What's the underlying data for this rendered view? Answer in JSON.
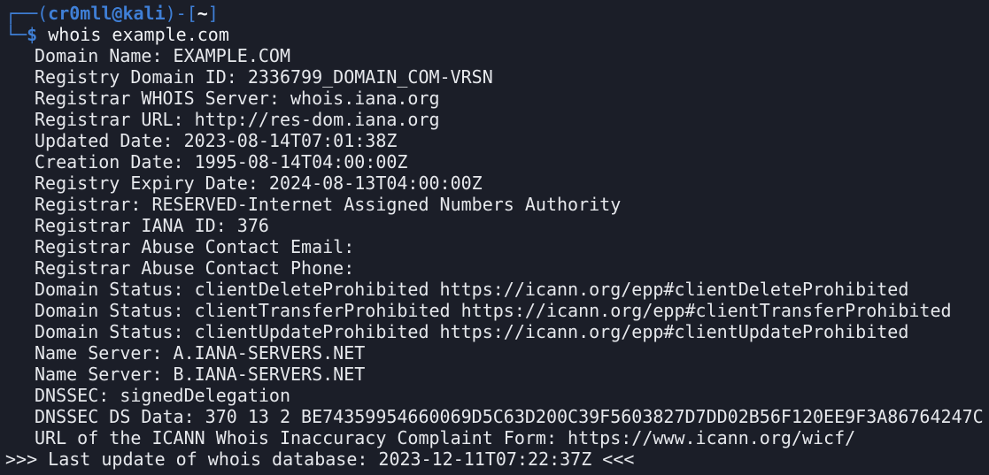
{
  "prompt": {
    "user_host": "cr0mll@kali",
    "cwd": "~",
    "symbol": "$",
    "command": "whois example.com"
  },
  "output_lines": [
    "Domain Name: EXAMPLE.COM",
    "Registry Domain ID: 2336799_DOMAIN_COM-VRSN",
    "Registrar WHOIS Server: whois.iana.org",
    "Registrar URL: http://res-dom.iana.org",
    "Updated Date: 2023-08-14T07:01:38Z",
    "Creation Date: 1995-08-14T04:00:00Z",
    "Registry Expiry Date: 2024-08-13T04:00:00Z",
    "Registrar: RESERVED-Internet Assigned Numbers Authority",
    "Registrar IANA ID: 376",
    "Registrar Abuse Contact Email:",
    "Registrar Abuse Contact Phone:",
    "Domain Status: clientDeleteProhibited https://icann.org/epp#clientDeleteProhibited",
    "Domain Status: clientTransferProhibited https://icann.org/epp#clientTransferProhibited",
    "Domain Status: clientUpdateProhibited https://icann.org/epp#clientUpdateProhibited",
    "Name Server: A.IANA-SERVERS.NET",
    "Name Server: B.IANA-SERVERS.NET",
    "DNSSEC: signedDelegation",
    "DNSSEC DS Data: 370 13 2 BE74359954660069D5C63D200C39F5603827D7DD02B56F120EE9F3A86764247C",
    "URL of the ICANN Whois Inaccuracy Complaint Form: https://www.icann.org/wicf/"
  ],
  "last_line": ">>> Last update of whois database: 2023-12-11T07:22:37Z <<<",
  "colors": {
    "background": "#1b1e28",
    "prompt_accent": "#3f7fd6",
    "text": "#e6e8ec"
  }
}
